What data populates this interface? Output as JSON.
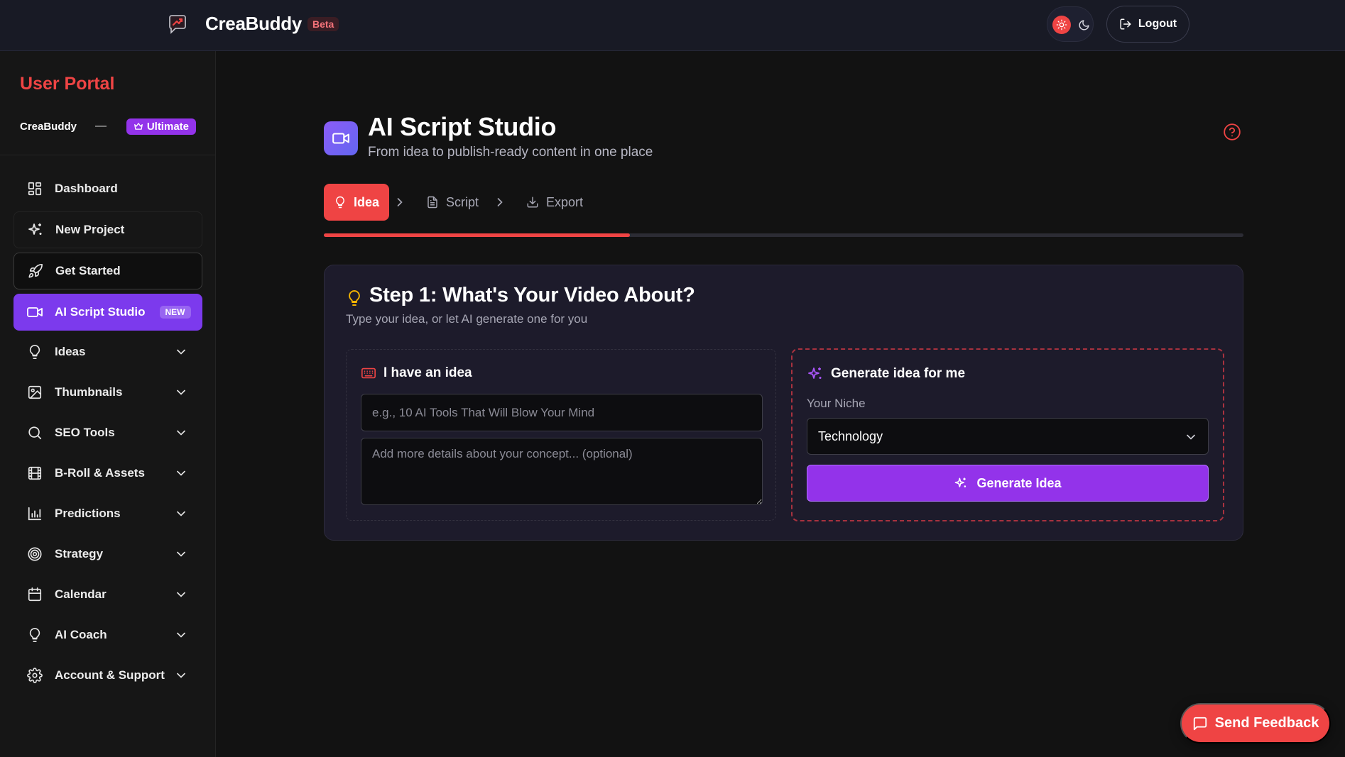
{
  "header": {
    "brand": "CreaBuddy",
    "badge": "Beta",
    "logout_label": "Logout",
    "icons": {
      "logo": "logo-chat-icon",
      "light_mode": "sun-icon",
      "dark_mode": "moon-icon",
      "logout": "logout-icon"
    }
  },
  "sidebar": {
    "portal_title": "User Portal",
    "user_name": "CreaBuddy",
    "user_separator": "—",
    "plan_label": "Ultimate",
    "items": [
      {
        "label": "Dashboard",
        "icon": "dashboard-icon"
      },
      {
        "label": "New Project",
        "icon": "sparkles-icon"
      },
      {
        "label": "Get Started",
        "icon": "rocket-icon"
      },
      {
        "label": "AI Script Studio",
        "icon": "video-icon",
        "badge": "NEW",
        "active": true
      },
      {
        "label": "Ideas",
        "icon": "lightbulb-icon",
        "expandable": true
      },
      {
        "label": "Thumbnails",
        "icon": "image-icon",
        "expandable": true
      },
      {
        "label": "SEO Tools",
        "icon": "search-icon",
        "expandable": true
      },
      {
        "label": "B-Roll & Assets",
        "icon": "film-icon",
        "expandable": true
      },
      {
        "label": "Predictions",
        "icon": "bar-chart-icon",
        "expandable": true
      },
      {
        "label": "Strategy",
        "icon": "target-icon",
        "expandable": true
      },
      {
        "label": "Calendar",
        "icon": "calendar-icon",
        "expandable": true
      },
      {
        "label": "AI Coach",
        "icon": "lightbulb-icon",
        "expandable": true
      },
      {
        "label": "Account & Support",
        "icon": "gear-icon",
        "expandable": true
      }
    ]
  },
  "main": {
    "title": "AI Script Studio",
    "subtitle": "From idea to publish-ready content in one place",
    "steps": [
      {
        "label": "Idea",
        "icon": "lightbulb-icon",
        "active": true
      },
      {
        "label": "Script",
        "icon": "document-icon"
      },
      {
        "label": "Export",
        "icon": "download-icon"
      }
    ],
    "progress_fraction": 0.333,
    "card": {
      "heading": "Step 1: What's Your Video About?",
      "subheading": "Type your idea, or let AI generate one for you",
      "manual": {
        "title": "I have an idea",
        "idea_placeholder": "e.g., 10 AI Tools That Will Blow Your Mind",
        "details_placeholder": "Add more details about your concept... (optional)"
      },
      "generate": {
        "title": "Generate idea for me",
        "niche_label": "Your Niche",
        "niche_value": "Technology",
        "button_label": "Generate Idea"
      }
    }
  },
  "feedback_label": "Send Feedback",
  "colors": {
    "accent_red": "#ef4444",
    "accent_purple": "#9333ea",
    "active_nav": "#7c3aed",
    "background": "#121212",
    "topbar": "#181a25",
    "card": "#1d1b2b"
  }
}
